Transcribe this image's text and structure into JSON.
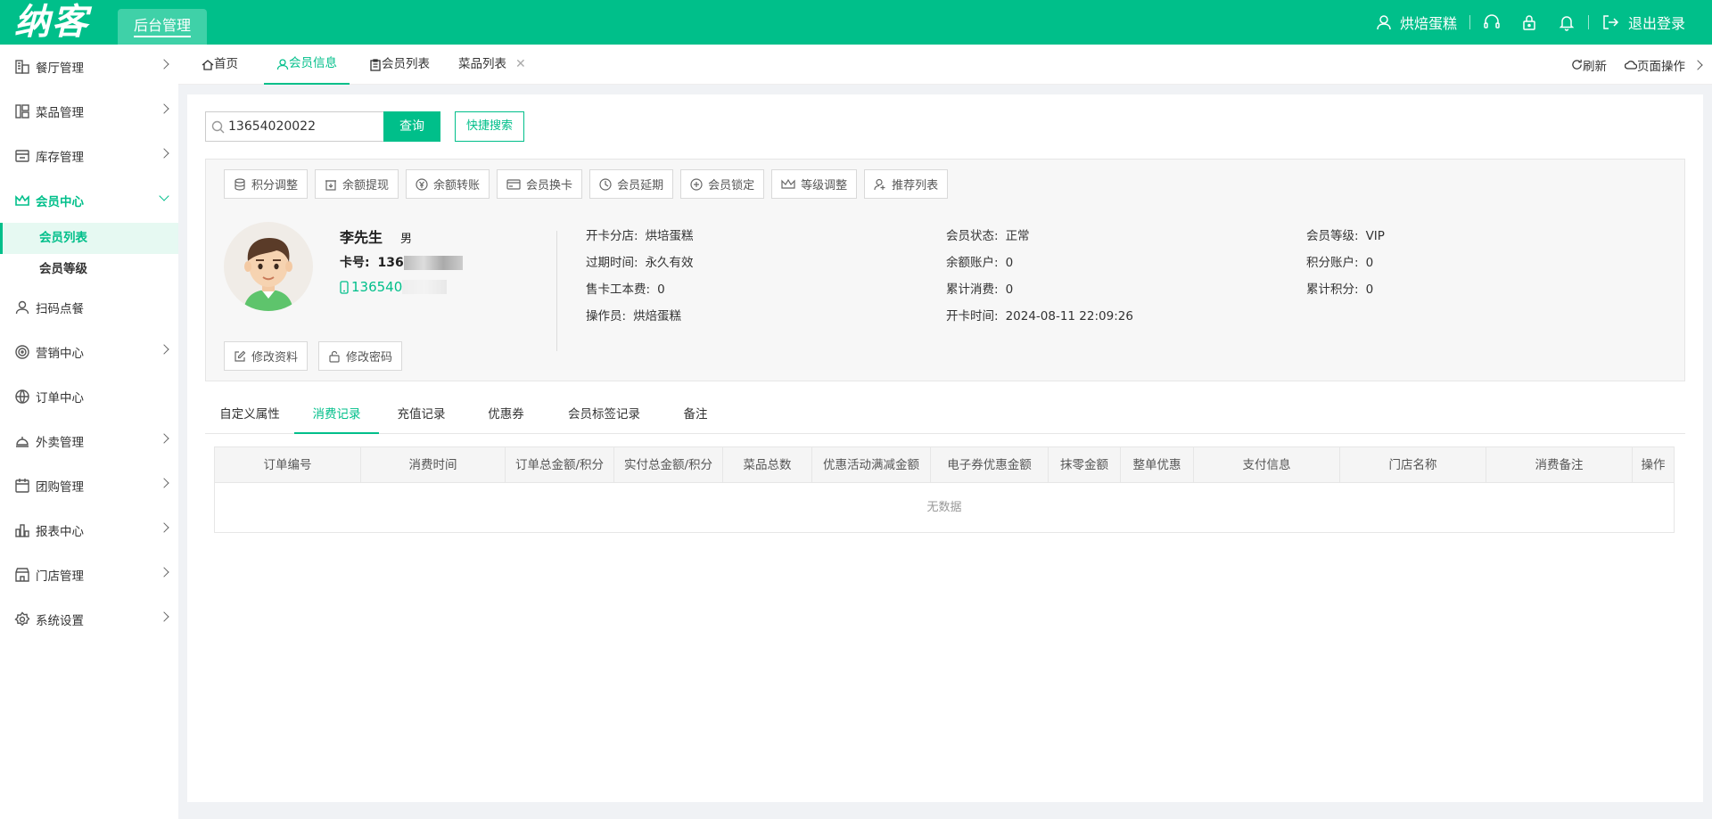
{
  "header": {
    "logo": "纳客",
    "admin_tab": "后台管理",
    "store_name": "烘焙蛋糕",
    "logout": "退出登录"
  },
  "sidebar": {
    "items": [
      {
        "label": "餐厅管理",
        "icon": "restaurant-icon"
      },
      {
        "label": "菜品管理",
        "icon": "dish-icon"
      },
      {
        "label": "库存管理",
        "icon": "inventory-icon"
      },
      {
        "label": "会员中心",
        "icon": "crown-icon"
      },
      {
        "label": "扫码点餐",
        "icon": "user-icon"
      },
      {
        "label": "营销中心",
        "icon": "target-icon"
      },
      {
        "label": "订单中心",
        "icon": "globe-icon"
      },
      {
        "label": "外卖管理",
        "icon": "takeout-icon"
      },
      {
        "label": "团购管理",
        "icon": "calendar-icon"
      },
      {
        "label": "报表中心",
        "icon": "chart-icon"
      },
      {
        "label": "门店管理",
        "icon": "store-icon"
      },
      {
        "label": "系统设置",
        "icon": "gear-icon"
      }
    ],
    "sub_items": [
      "会员列表",
      "会员等级"
    ]
  },
  "tabs": {
    "home": "首页",
    "member_info": "会员信息",
    "member_list": "会员列表",
    "dish_list": "菜品列表",
    "refresh": "刷新",
    "page_ops": "页面操作"
  },
  "search": {
    "value": "13654020022",
    "query_btn": "查询",
    "quick_btn": "快捷搜索"
  },
  "actions": [
    "积分调整",
    "余额提现",
    "余额转账",
    "会员换卡",
    "会员延期",
    "会员锁定",
    "等级调整",
    "推荐列表"
  ],
  "member": {
    "name": "李先生",
    "sex": "男",
    "card_label": "卡号:",
    "card_prefix": "136",
    "phone_prefix": "136540"
  },
  "info": {
    "open_store_label": "开卡分店:",
    "open_store": "烘培蛋糕",
    "expire_label": "过期时间:",
    "expire": "永久有效",
    "card_cost_label": "售卡工本费:",
    "card_cost": "0",
    "operator_label": "操作员:",
    "operator": "烘焙蛋糕",
    "status_label": "会员状态:",
    "status": "正常",
    "balance_label": "余额账户:",
    "balance": "0",
    "total_consume_label": "累计消费:",
    "total_consume": "0",
    "open_time_label": "开卡时间:",
    "open_time": "2024-08-11 22:09:26",
    "level_label": "会员等级:",
    "level": "VIP",
    "points_label": "积分账户:",
    "points": "0",
    "total_points_label": "累计积分:",
    "total_points": "0"
  },
  "edit": {
    "edit_profile": "修改资料",
    "edit_password": "修改密码"
  },
  "subtabs": [
    "自定义属性",
    "消费记录",
    "充值记录",
    "优惠券",
    "会员标签记录",
    "备注"
  ],
  "table": {
    "columns": [
      "订单编号",
      "消费时间",
      "订单总金额/积分",
      "实付总金额/积分",
      "菜品总数",
      "优惠活动满减金额",
      "电子券优惠金额",
      "抹零金额",
      "整单优惠",
      "支付信息",
      "门店名称",
      "消费备注",
      "操作"
    ],
    "empty": "无数据"
  },
  "colors": {
    "brand": "#00bf8a"
  }
}
